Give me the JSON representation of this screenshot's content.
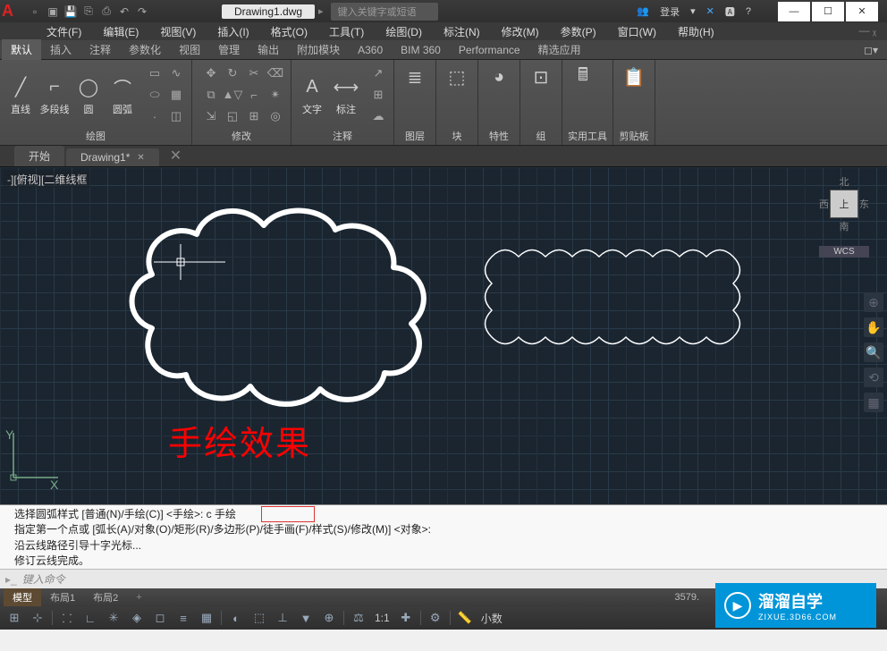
{
  "title": "Drawing1.dwg",
  "search_placeholder": "键入关键字或短语",
  "login": "登录",
  "menubar": [
    "文件(F)",
    "编辑(E)",
    "视图(V)",
    "插入(I)",
    "格式(O)",
    "工具(T)",
    "绘图(D)",
    "标注(N)",
    "修改(M)",
    "参数(P)",
    "窗口(W)",
    "帮助(H)"
  ],
  "ribbon_tabs": [
    "默认",
    "插入",
    "注释",
    "参数化",
    "视图",
    "管理",
    "输出",
    "附加模块",
    "A360",
    "BIM 360",
    "Performance",
    "精选应用"
  ],
  "ribbon": {
    "draw": {
      "label": "绘图",
      "items": [
        "直线",
        "多段线",
        "圆",
        "圆弧"
      ]
    },
    "modify": {
      "label": "修改"
    },
    "annotate": {
      "label": "注释",
      "items": [
        "文字",
        "标注"
      ]
    },
    "layers": {
      "label": "图层"
    },
    "blocks": {
      "label": "块"
    },
    "props": {
      "label": "特性"
    },
    "groups": {
      "label": "组"
    },
    "utils": {
      "label": "实用工具"
    },
    "clip": {
      "label": "剪贴板"
    }
  },
  "filetabs": {
    "start": "开始",
    "doc": "Drawing1*"
  },
  "viewlabel": "-][俯视][二维线框",
  "viewcube": {
    "n": "北",
    "s": "南",
    "e": "东",
    "w": "西",
    "top": "上",
    "wcs": "WCS"
  },
  "annotation": "手绘效果",
  "ucs": {
    "x": "X",
    "y": "Y"
  },
  "cmdlog": {
    "l1": "选择圆弧样式 [普通(N)/手绘(C)] <手绘>: c  手绘",
    "l2": "指定第一个点或 [弧长(A)/对象(O)/矩形(R)/多边形(P)/徒手画(F)/样式(S)/修改(M)] <对象>:",
    "l3": "沿云线路径引导十字光标...",
    "l4": "修订云线完成。"
  },
  "cmdline_placeholder": "键入命令",
  "modeltabs": [
    "模型",
    "布局1",
    "布局2"
  ],
  "statusbar": {
    "coord": "3579.",
    "scale": "1:1",
    "decimal": "小数"
  },
  "watermark": {
    "brand": "溜溜自学",
    "url": "ZIXUE.3D66.COM"
  }
}
